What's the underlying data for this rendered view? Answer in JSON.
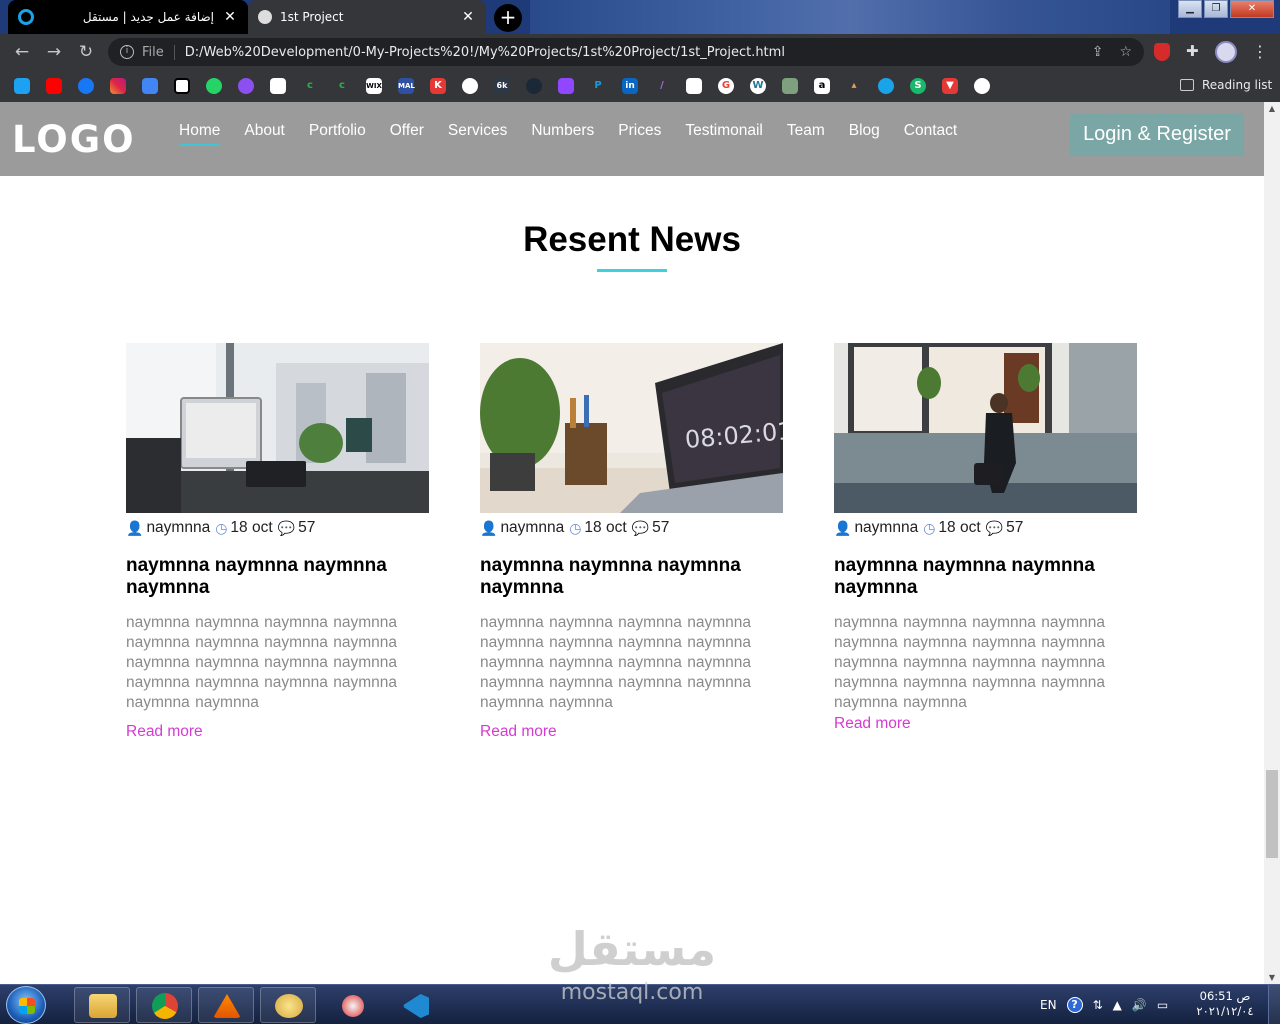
{
  "browser": {
    "tabs": [
      {
        "title": "إضافة عمل جديد | مستقل",
        "active": false
      },
      {
        "title": "1st Project",
        "active": true
      }
    ],
    "address": {
      "scheme": "File",
      "url": "D:/Web%20Development/0-My-Projects%20!/My%20Projects/1st%20Project/1st_Project.html"
    },
    "bookmarks": [
      "twitter-icon",
      "youtube-icon",
      "facebook-icon",
      "instagram-icon",
      "translate-icon",
      "codepen-icon",
      "whatsapp-icon",
      "udemy-icon",
      "codecademy-icon",
      "c-icon",
      "c-icon",
      "wix-icon",
      "mal-icon",
      "k-icon",
      "spy-icon",
      "6k-icon",
      "steam-icon",
      "twitch-icon",
      "paypal-icon",
      "linkedin-icon",
      "feather-icon",
      "flipboard-icon",
      "google-icon",
      "wordpress-icon",
      "image-icon",
      "amazon-icon",
      "cart-icon",
      "circle-icon",
      "s-icon",
      "download-icon",
      "globe-icon"
    ],
    "reading_list": "Reading list"
  },
  "site": {
    "logo": "LOGO",
    "nav": [
      "Home",
      "About",
      "Portfolio",
      "Offer",
      "Services",
      "Numbers",
      "Prices",
      "Testimonail",
      "Team",
      "Blog",
      "Contact"
    ],
    "active_nav": "Home",
    "login": "Login & Register",
    "accent": "#3fc5d3",
    "header_bg": "#9b9b9b",
    "link_color": "#d63ad0"
  },
  "news": {
    "title": "Resent News",
    "cards": [
      {
        "image": "office-desk-photo",
        "author": "naymnna",
        "date": "18 oct",
        "comments": "57",
        "title": "naymnna naymnna naymnna naymnna",
        "text": "naymnna naymnna naymnna naymnna naymnna naymnna naymnna naymnna naymnna naymnna naymnna naymnna naymnna naymnna naymnna naymnna naymnna naymnna",
        "link": "Read more"
      },
      {
        "image": "laptop-plant-photo",
        "author": "naymnna",
        "date": "18 oct",
        "comments": "57",
        "title": "naymnna naymnna naymnna naymnna",
        "text": "naymnna naymnna naymnna naymnna naymnna naymnna naymnna naymnna naymnna naymnna naymnna naymnna naymnna naymnna naymnna naymnna naymnna naymnna",
        "link": "Read more"
      },
      {
        "image": "man-walking-photo",
        "author": "naymnna",
        "date": "18 oct",
        "comments": "57",
        "title": "naymnna naymnna naymnna naymnna",
        "text": "naymnna naymnna naymnna naymnna naymnna naymnna naymnna naymnna naymnna naymnna naymnna naymnna naymnna naymnna naymnna naymnna naymnna naymnna",
        "link": "Read more"
      }
    ]
  },
  "watermark": {
    "arabic": "مستقل",
    "latin": "mostaql.com"
  },
  "taskbar": {
    "apps": [
      "file-explorer-icon",
      "chrome-icon",
      "vlc-icon",
      "paint-icon",
      "snipping-tool-icon",
      "vscode-icon"
    ],
    "lang": "EN",
    "time": "06:51 ص",
    "date": "٢٠٢١/١٢/٠٤"
  }
}
